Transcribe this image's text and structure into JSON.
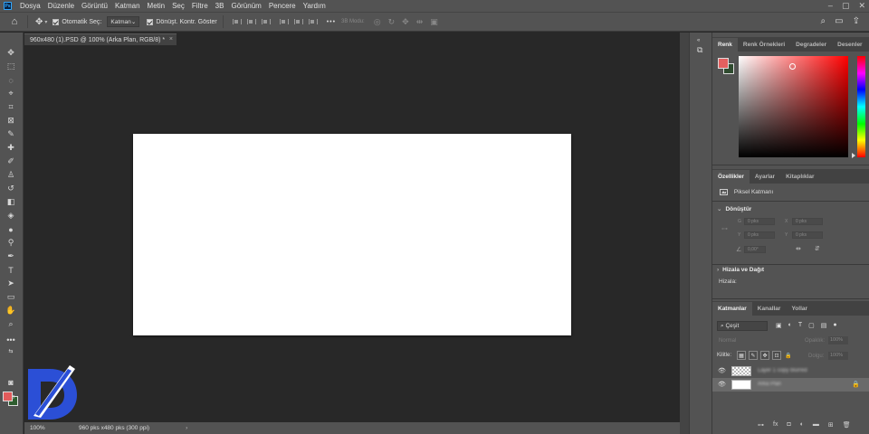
{
  "app": {
    "logo": "Ps",
    "menu": [
      "Dosya",
      "Düzenle",
      "Görüntü",
      "Katman",
      "Metin",
      "Seç",
      "Filtre",
      "3B",
      "Görünüm",
      "Pencere",
      "Yardım"
    ]
  },
  "options_bar": {
    "auto_select_label": "Otomatik Seç:",
    "auto_select_value": "Katman",
    "transform_controls_label": "Dönüşt. Kontr. Göster",
    "mode_3d_label": "3B Modu:"
  },
  "document": {
    "tab_title": "960x480 (1).PSD @ 100% (Arka Plan, RGB/8) *",
    "close_glyph": "×",
    "canvas_color": "#ffffff"
  },
  "status_bar": {
    "zoom": "100%",
    "info": "960 pks x480 pks (300 ppi)",
    "arrow": "›"
  },
  "colors": {
    "foreground": "#e36060",
    "background": "#2f4b2f",
    "accent_ps": "#31a8ff"
  },
  "color_panel": {
    "tabs": [
      "Renk",
      "Renk Örnekleri",
      "Degradeler",
      "Desenler"
    ],
    "active_tab": "Renk"
  },
  "properties_panel": {
    "tabs": [
      "Özellikler",
      "Ayarlar",
      "Kitaplıklar"
    ],
    "active_tab": "Özellikler",
    "layer_kind": "Piksel Katmanı",
    "transform_section": "Dönüştür",
    "w_label": "G",
    "w_value": "0 pks",
    "h_label": "Y",
    "h_value": "0 pks",
    "x_label": "X",
    "x_value": "0 pks",
    "y_label": "Y",
    "y_value": "0 pks",
    "angle_value": "0,00°",
    "align_section": "Hizala ve Dağıt",
    "align_label": "Hizala:"
  },
  "layers_panel": {
    "tabs": [
      "Katmanlar",
      "Kanallar",
      "Yollar"
    ],
    "active_tab": "Katmanlar",
    "filter_value": "Çeşit",
    "blend_mode": "Normal",
    "opacity_label": "Opaklık:",
    "opacity_value": "100%",
    "lock_label": "Kilitle:",
    "fill_label": "Dolgu:",
    "fill_value": "100%",
    "layers": [
      {
        "name": "Layer 1 copy blurred",
        "visible": true,
        "selected": false,
        "thumb": "checker"
      },
      {
        "name": "Arka Plan",
        "visible": true,
        "selected": true,
        "thumb": "white",
        "locked": true
      }
    ]
  },
  "icons": {
    "home": "⌂",
    "move": "✥",
    "eye": "👁",
    "lock": "🔒",
    "search": "⌕",
    "more": "•••"
  }
}
